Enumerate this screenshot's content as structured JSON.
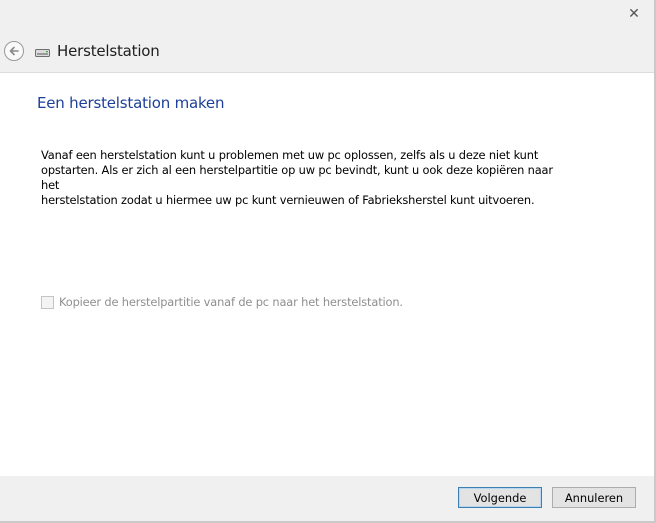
{
  "window": {
    "close_glyph": "✕"
  },
  "nav": {
    "back_icon": "back-arrow-icon",
    "drive_icon": "recovery-drive-icon",
    "title": "Herstelstation"
  },
  "main": {
    "heading": "Een herstelstation maken",
    "description_lines": [
      "Vanaf een herstelstation kunt u problemen met uw pc oplossen, zelfs als u deze niet kunt",
      "opstarten. Als er zich al een herstelpartitie op uw pc bevindt, kunt u ook deze kopiëren naar het",
      "herstelstation zodat u hiermee uw pc kunt vernieuwen of Fabrieksherstel kunt uitvoeren."
    ],
    "checkbox": {
      "label": "Kopieer de herstelpartitie vanaf de pc naar het herstelstation.",
      "checked": false,
      "disabled": true
    }
  },
  "footer": {
    "next_label": "Volgende",
    "cancel_label": "Annuleren"
  },
  "colors": {
    "heading": "#1d3f9a",
    "accent_border": "#3c7fb1",
    "disabled_text": "#8f8f8f"
  }
}
